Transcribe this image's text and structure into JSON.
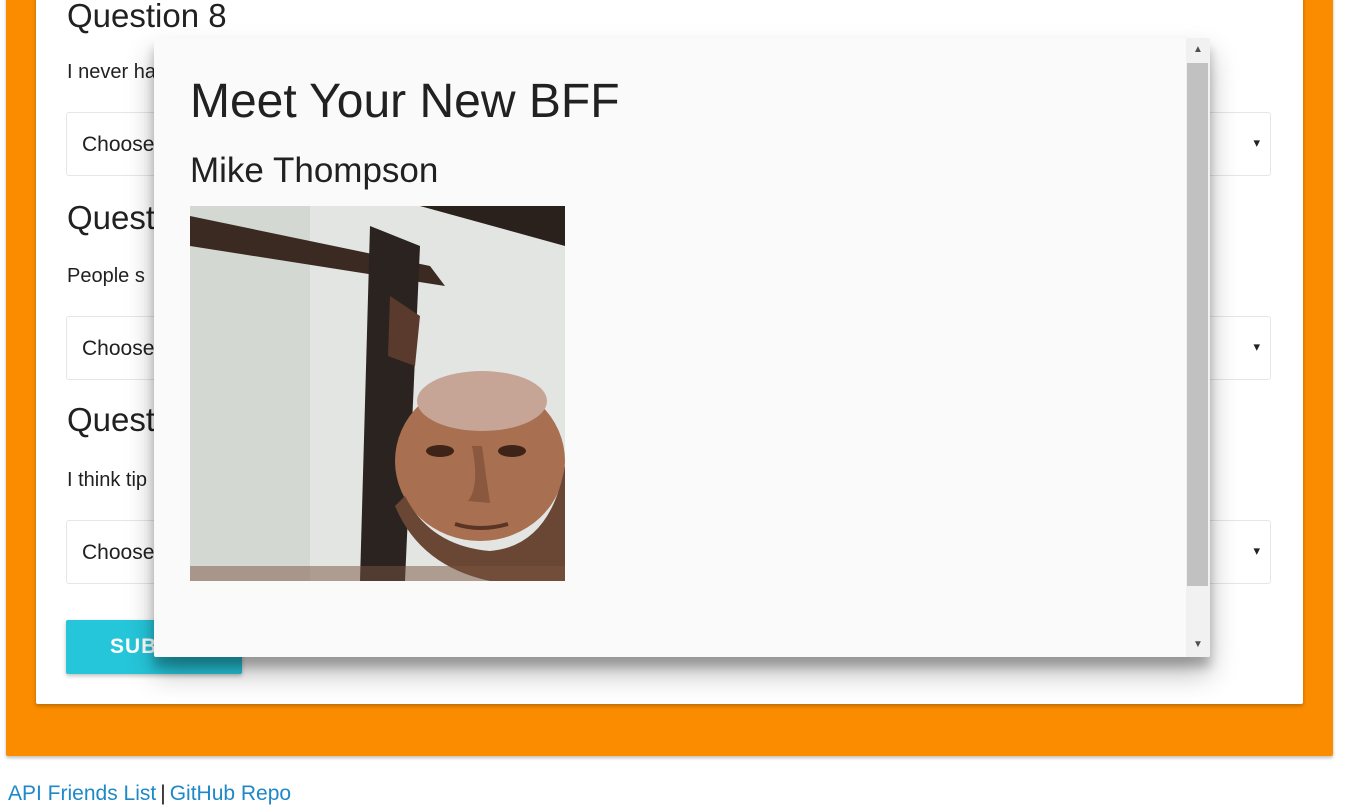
{
  "survey": {
    "question8": {
      "title": "Question 8",
      "text": "I never ha",
      "select_value": "Choose"
    },
    "question9": {
      "title": "Quest",
      "text": "People s",
      "select_value": "Choose"
    },
    "question10": {
      "title": "Quest",
      "text": "I think tip",
      "select_value": "Choose"
    },
    "select_arrow": "▾",
    "submit_label": "SUB"
  },
  "modal": {
    "title": "Meet Your New BFF",
    "friend_name": "Mike Thompson",
    "photo_icon": "person-photo",
    "scroll_up": "▲",
    "scroll_down": "▼"
  },
  "footer": {
    "api_link": "API Friends List",
    "separator": "|",
    "github_link": "GitHub Repo"
  },
  "colors": {
    "panel_background": "#fb8c00",
    "submit_button": "#26c6da",
    "link": "#1e88c8"
  }
}
